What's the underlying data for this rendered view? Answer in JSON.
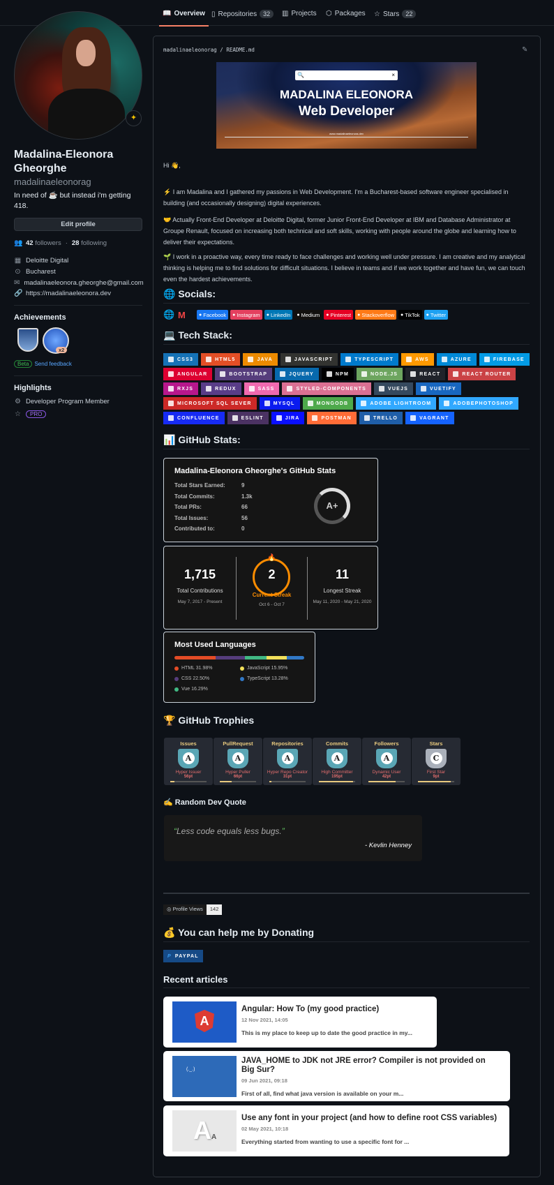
{
  "nav": {
    "tabs": [
      {
        "label": "Overview",
        "icon": "book-icon"
      },
      {
        "label": "Repositories",
        "icon": "repo-icon",
        "count": "32"
      },
      {
        "label": "Projects",
        "icon": "project-icon"
      },
      {
        "label": "Packages",
        "icon": "package-icon"
      },
      {
        "label": "Stars",
        "icon": "star-icon",
        "count": "22"
      }
    ]
  },
  "profile": {
    "name": "Madalina-Eleonora Gheorghe",
    "username": "madalinaeleonorag",
    "bio": "In need of ☕ but instead i'm getting 418.",
    "edit": "Edit profile",
    "followers": "42",
    "followers_label": "followers",
    "following": "28",
    "following_label": "following",
    "company": "Deloitte Digital",
    "location": "Bucharest",
    "email": "madalinaeleonora.gheorghe@gmail.com",
    "website": "https://madalinaeleonora.dev",
    "achievements_title": "Achievements",
    "achievement_count": "x2",
    "beta": "Beta",
    "feedback": "Send feedback",
    "highlights_title": "Highlights",
    "highlight1": "Developer Program Member",
    "pro": "PRO"
  },
  "readme": {
    "path_user": "madalinaeleonorag",
    "path_sep": "/",
    "path_file": "README.md",
    "banner": {
      "line1": "MADALINA ELEONORA",
      "line2": "Web Developer",
      "url": "www.madalinaeleonora.dev"
    },
    "hi": "Hi 👋,",
    "p1": "⚡ I am Madalina and I gathered my passions in Web Development. I'm a Bucharest-based software engineer specialised in building (and occasionally designing) digital experiences.",
    "p2": "🤝 Actually Front-End Developer at Deloitte Digital, former Junior Front-End Developer at IBM and Database Administrator at Groupe Renault, focused on increasing both technical and soft skills, working with people around the globe and learning how to deliver their expectations.",
    "p3": "🌱 I work in a proactive way, every time ready to face challenges and working well under pressure. I am creative and my analytical thinking is helping me to find solutions for difficult situations. I believe in teams and if we work together and have fun, we can touch even the hardest achievements.",
    "socials_title": "🌐 Socials:",
    "socials": [
      {
        "label": "Facebook",
        "color": "#1877F2"
      },
      {
        "label": "Instagram",
        "color": "#E4405F"
      },
      {
        "label": "LinkedIn",
        "color": "#0077B5"
      },
      {
        "label": "Medium",
        "color": "#12100E"
      },
      {
        "label": "Pinterest",
        "color": "#E60023"
      },
      {
        "label": "Stackoverflow",
        "color": "#FE7A16"
      },
      {
        "label": "TikTok",
        "color": "#000000"
      },
      {
        "label": "Twitter",
        "color": "#1DA1F2"
      }
    ],
    "tech_title": "💻 Tech Stack:",
    "tech": [
      {
        "label": "CSS3",
        "color": "#1572B6"
      },
      {
        "label": "HTML5",
        "color": "#E34F26"
      },
      {
        "label": "JAVA",
        "color": "#ED8B00"
      },
      {
        "label": "JAVASCRIPT",
        "color": "#323330"
      },
      {
        "label": "TYPESCRIPT",
        "color": "#007ACC"
      },
      {
        "label": "AWS",
        "color": "#FF9900"
      },
      {
        "label": "AZURE",
        "color": "#0089D6"
      },
      {
        "label": "FIREBASE",
        "color": "#039BE5"
      },
      {
        "label": "ANGULAR",
        "color": "#DD0031"
      },
      {
        "label": "BOOTSTRAP",
        "color": "#563D7C"
      },
      {
        "label": "JQUERY",
        "color": "#0769AD"
      },
      {
        "label": "NPM",
        "color": "#000000"
      },
      {
        "label": "NODE.JS",
        "color": "#6DA55F"
      },
      {
        "label": "REACT",
        "color": "#20232A"
      },
      {
        "label": "REACT ROUTER",
        "color": "#CA4245"
      },
      {
        "label": "RXJS",
        "color": "#B7178C"
      },
      {
        "label": "REDUX",
        "color": "#593D88"
      },
      {
        "label": "SASS",
        "color": "#F06AAF"
      },
      {
        "label": "STYLED-COMPONENTS",
        "color": "#DB7093"
      },
      {
        "label": "VUEJS",
        "color": "#35495E"
      },
      {
        "label": "VUETIFY",
        "color": "#1867C0"
      },
      {
        "label": "MICROSOFT SQL SEVER",
        "color": "#CC2927"
      },
      {
        "label": "MYSQL",
        "color": "#0A1BF0"
      },
      {
        "label": "MONGODB",
        "color": "#4EA94B"
      },
      {
        "label": "ADOBE LIGHTROOM",
        "color": "#31A8FF"
      },
      {
        "label": "ADOBEPHOTOSHOP",
        "color": "#31A8FF"
      },
      {
        "label": "CONFLUENCE",
        "color": "#172BF4"
      },
      {
        "label": "ESLINT",
        "color": "#4B3263"
      },
      {
        "label": "JIRA",
        "color": "#0A0FFF"
      },
      {
        "label": "POSTMAN",
        "color": "#FF6C37"
      },
      {
        "label": "TRELLO",
        "color": "#1F5EA8"
      },
      {
        "label": "VAGRANT",
        "color": "#1563FF"
      }
    ],
    "stats_title": "📊 GitHub Stats:",
    "stats": {
      "title": "Madalina-Eleonora Gheorghe's GitHub Stats",
      "rows": [
        {
          "label": "Total Stars Earned:",
          "value": "9"
        },
        {
          "label": "Total Commits:",
          "value": "1.3k"
        },
        {
          "label": "Total PRs:",
          "value": "66"
        },
        {
          "label": "Total Issues:",
          "value": "56"
        },
        {
          "label": "Contributed to:",
          "value": "0"
        }
      ],
      "grade": "A+"
    },
    "streak": {
      "total": "1,715",
      "total_label": "Total Contributions",
      "total_range": "May 7, 2017 - Present",
      "current": "2",
      "current_label": "Current Streak",
      "current_range": "Oct 6 - Oct 7",
      "longest": "11",
      "longest_label": "Longest Streak",
      "longest_range": "May 11, 2020 - May 21, 2020",
      "accent": "#FB8C00"
    },
    "languages": {
      "title": "Most Used Languages",
      "items": [
        {
          "name": "HTML",
          "pct": 31.98,
          "label": "HTML 31.98%",
          "color": "#E34C26"
        },
        {
          "name": "CSS",
          "pct": 22.5,
          "label": "CSS 22.50%",
          "color": "#563D7C"
        },
        {
          "name": "Vue",
          "pct": 16.29,
          "label": "Vue 16.29%",
          "color": "#41B883"
        },
        {
          "name": "JavaScript",
          "pct": 15.95,
          "label": "JavaScript 15.95%",
          "color": "#F1E05A"
        },
        {
          "name": "TypeScript",
          "pct": 13.28,
          "label": "TypeScript 13.28%",
          "color": "#3178C6"
        }
      ]
    },
    "trophies_title": "🏆 GitHub Trophies",
    "trophies": [
      {
        "title": "Issues",
        "rank": "A",
        "name": "Hyper Issuer",
        "points": "56pt",
        "progress": 0.12
      },
      {
        "title": "PullRequest",
        "rank": "A",
        "name": "Hyper Puller",
        "points": "66pt",
        "progress": 0.32
      },
      {
        "title": "Repositories",
        "rank": "A",
        "name": "Hyper Repo Creator",
        "points": "31pt",
        "progress": 0.05
      },
      {
        "title": "Commits",
        "rank": "A",
        "name": "High Committer",
        "points": "195pt",
        "progress": 0.95
      },
      {
        "title": "Followers",
        "rank": "A",
        "name": "Dynamic User",
        "points": "42pt",
        "progress": 0.75
      },
      {
        "title": "Stars",
        "rank": "C",
        "name": "First Star",
        "points": "9pt",
        "progress": 0.9
      }
    ],
    "quote_title": "✍️ Random Dev Quote",
    "quote": {
      "text": "Less code equals less bugs.",
      "author": "- Kevlin Henney"
    },
    "views_label": "Profile Views",
    "views": "142",
    "donate_title": "💰 You can help me by Donating",
    "paypal": "PAYPAL",
    "articles_title": "Recent articles",
    "articles": [
      {
        "title": "Angular: How To (my good practice)",
        "date": "12 Nov 2021, 14:05",
        "desc": "This is my place to keep up to date the good practice in my..."
      },
      {
        "title": "JAVA_HOME to JDK not JRE error? Compiler is not provided on Big Sur?",
        "date": "09 Jun 2021, 09:18",
        "desc": "First of all, find what java version is available on your m..."
      },
      {
        "title": "Use any font in your project (and how to define root CSS variables)",
        "date": "02 May 2021, 10:18",
        "desc": "Everything started from wanting to use a specific font for ..."
      }
    ]
  }
}
